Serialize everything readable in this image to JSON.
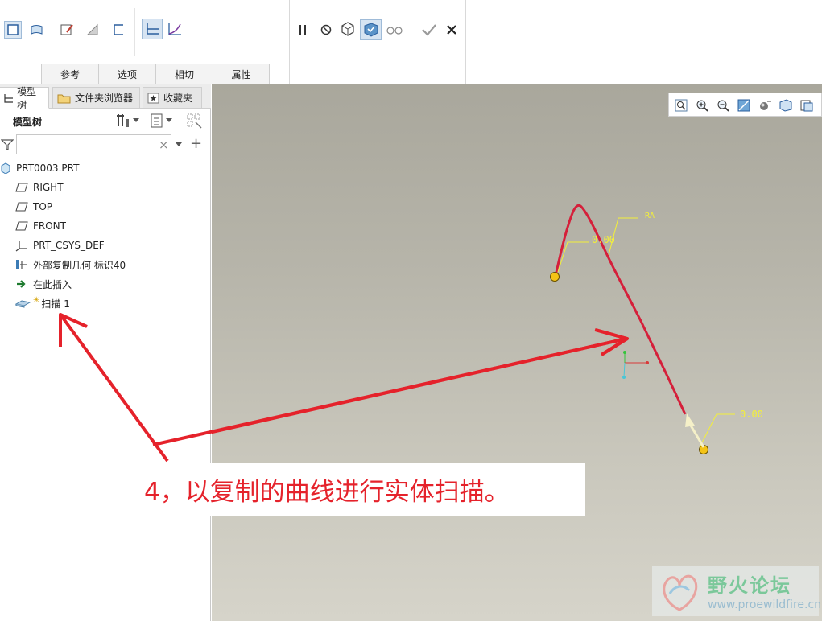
{
  "ribbon": {
    "tabs": [
      "参考",
      "选项",
      "相切",
      "属性"
    ]
  },
  "icons": {
    "ribbon_left": [
      "solid-icon",
      "surface-icon",
      "edit-section-icon",
      "remove-material-icon",
      "thicken-icon",
      "constant-section-icon",
      "variable-section-icon"
    ],
    "ribbon_right": [
      "pause-icon",
      "no-preview-icon",
      "preview-geometry-icon",
      "verify-mode-icon",
      "glasses-preview-icon",
      "ok-icon",
      "cancel-icon"
    ],
    "view_toolbar": [
      "refit-icon",
      "zoom-in-icon",
      "zoom-out-icon",
      "repaint-icon",
      "display-style-icon",
      "saved-orientation-icon",
      "view-manager-icon"
    ]
  },
  "navigator": {
    "tabs": [
      "模型树",
      "文件夹浏览器",
      "收藏夹"
    ],
    "tree_title": "模型树",
    "filter_placeholder": "",
    "filter_clear": "×"
  },
  "tree": [
    {
      "label": "PRT0003.PRT",
      "icon": "part-icon"
    },
    {
      "label": "RIGHT",
      "icon": "datum-plane-icon"
    },
    {
      "label": "TOP",
      "icon": "datum-plane-icon"
    },
    {
      "label": "FRONT",
      "icon": "datum-plane-icon"
    },
    {
      "label": "PRT_CSYS_DEF",
      "icon": "csys-icon"
    },
    {
      "label": "外部复制几何 标识40",
      "icon": "copy-geom-icon"
    },
    {
      "label": "在此插入",
      "icon": "insert-here-icon"
    },
    {
      "label": "扫描 1",
      "icon": "sweep-icon"
    }
  ],
  "canvas": {
    "dim_top_a": "0.00",
    "dim_top_b": "RA",
    "dim_bottom": "0.00"
  },
  "annotation": "4，以复制的曲线进行实体扫描。",
  "watermark": {
    "name": "野火论坛",
    "url": "www.proewildfire.cn"
  },
  "colors": {
    "annotation_red": "#e5222b",
    "curve_red": "#d51f3a",
    "dim_yellow": "#f3ef3a",
    "endpoint_yellow": "#f4c316"
  }
}
